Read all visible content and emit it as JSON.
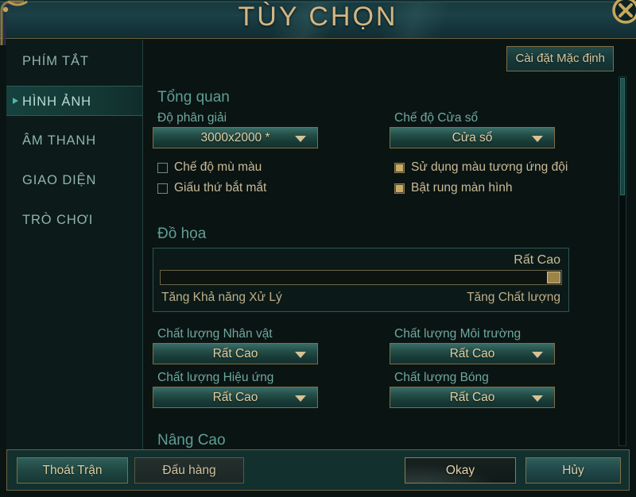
{
  "window": {
    "title": "TÙY CHỌN",
    "close_icon": "close-circle-icon"
  },
  "sidebar": {
    "items": [
      {
        "label": "PHÍM TẮT",
        "active": false
      },
      {
        "label": "HÌNH ẢNH",
        "active": true
      },
      {
        "label": "ÂM THANH",
        "active": false
      },
      {
        "label": "GIAO DIỆN",
        "active": false
      },
      {
        "label": "TRÒ CHƠI",
        "active": false
      }
    ]
  },
  "toolbar": {
    "defaults_label": "Cài đặt Mặc định"
  },
  "sections": {
    "overview": {
      "title": "Tổng quan",
      "resolution": {
        "label": "Độ phân giải",
        "value": "3000x2000 *"
      },
      "window_mode": {
        "label": "Chế độ Cửa sổ",
        "value": "Cửa sổ"
      },
      "checkboxes": [
        {
          "label": "Chế độ mù màu",
          "checked": false
        },
        {
          "label": "Giấu thứ bắt mắt",
          "checked": false
        },
        {
          "label": "Sử dụng màu tương ứng đội",
          "checked": true
        },
        {
          "label": "Bật rung màn hình",
          "checked": true
        }
      ]
    },
    "graphics": {
      "title": "Đồ họa",
      "quality_level": "Rất Cao",
      "slider_position_pct": 100,
      "foot_left": "Tăng Khả năng Xử Lý",
      "foot_right": "Tăng Chất lượng",
      "dropdowns": [
        {
          "label": "Chất lượng Nhân vật",
          "value": "Rất Cao"
        },
        {
          "label": "Chất lượng Môi trường",
          "value": "Rất Cao"
        },
        {
          "label": "Chất lượng Hiệu ứng",
          "value": "Rất Cao"
        },
        {
          "label": "Chất lượng Bóng",
          "value": "Rất Cao"
        }
      ]
    },
    "advanced": {
      "title": "Nâng Cao"
    }
  },
  "footer": {
    "quit_label": "Thoát Trận",
    "surrender_label": "Đấu hàng",
    "okay_label": "Okay",
    "cancel_label": "Hủy"
  }
}
